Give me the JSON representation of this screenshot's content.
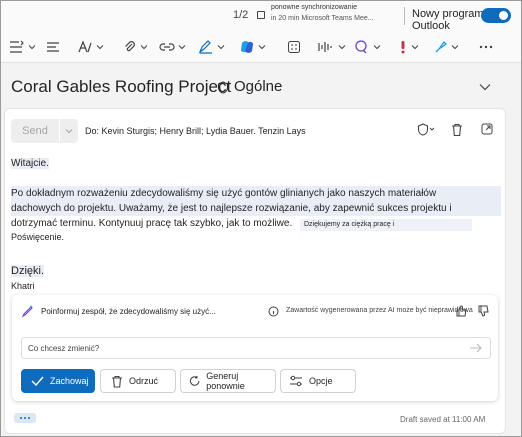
{
  "topbar": {
    "counter": "1/2",
    "notification_title": "ponowne synchronizowanie",
    "notification_sub": "in 20 min Microsoft Teams Mee...",
    "new_outlook_label": "Nowy program Outlook",
    "new_outlook_enabled": true
  },
  "ribbon": {
    "icons": [
      "list-format-icon",
      "text-style-icon",
      "attach-icon",
      "link-icon",
      "signature-icon",
      "copilot-icon",
      "apps-icon",
      "dictate-icon",
      "loop-icon",
      "importance-icon",
      "sensitivity-icon",
      "more-icon"
    ]
  },
  "message": {
    "subject": "Coral Gables Roofing Project",
    "category": "Ogólne",
    "send_label": "Send",
    "to_line": "Do: Kevin Sturgis; Henry Brill; Lydia Bauer. Tenzin Lays",
    "greeting": "Witajcie.",
    "paragraph_lines": [
      "Po dokładnym rozważeniu zdecydowaliśmy się użyć gontów glinianych jako naszych materiałów",
      "dachowych do projektu. Uważamy, że jest to najlepsze rozwiązanie, aby zapewnić sukces projektu i",
      "dotrzymać terminu. Kontynuuj pracę tak szybko, jak to możliwe.",
      "Poświęcenie."
    ],
    "tooltip": "Dziękujemy za ciężką pracę i",
    "closing": "Dzięki.",
    "signature": "Khatri"
  },
  "copilot": {
    "prompt_title": "Poinformuj zespół, że zdecydowaliśmy się użyć...",
    "disclaimer": "Zawartość wygenerowana przez AI może być nieprawidłowa",
    "input_placeholder": "Co chcesz zmienić?",
    "buttons": {
      "keep": "Zachowaj",
      "discard": "Odrzuć",
      "regenerate": "Generuj ponownie",
      "options": "Opcje"
    }
  },
  "footer": {
    "draft_status": "Draft saved at 11:00 AM"
  },
  "colors": {
    "accent": "#0f6cbd",
    "copilot_blue": "#1aa0e6",
    "importance_red": "#c4314b",
    "highlight": "#e9eef6"
  }
}
